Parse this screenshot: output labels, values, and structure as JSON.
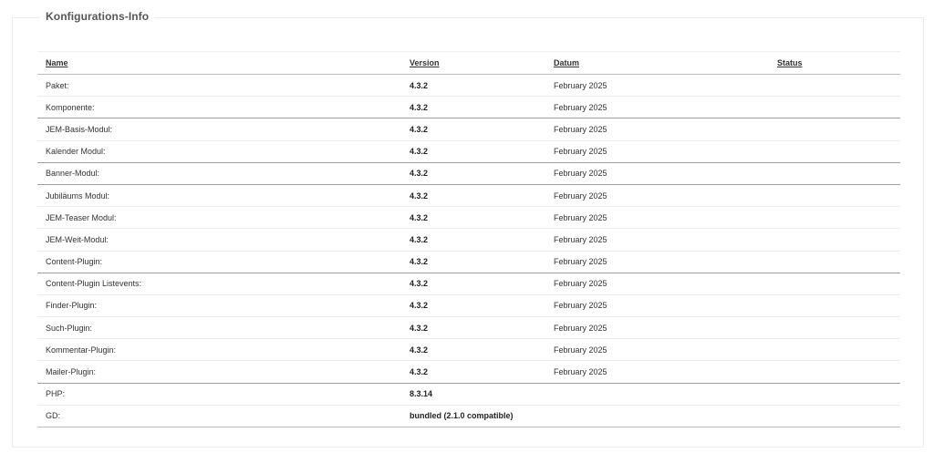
{
  "panel": {
    "legend": "Konfigurations-Info"
  },
  "table": {
    "headers": {
      "name": "Name",
      "version": "Version",
      "datum": "Datum",
      "status": "Status"
    },
    "rows": [
      {
        "name": "Paket:",
        "version": "4.3.2",
        "datum": "February 2025",
        "status": ""
      },
      {
        "name": "Komponente:",
        "version": "4.3.2",
        "datum": "February 2025",
        "status": ""
      },
      {
        "name": "JEM-Basis-Modul:",
        "version": "4.3.2",
        "datum": "February 2025",
        "status": ""
      },
      {
        "name": "Kalender Modul:",
        "version": "4.3.2",
        "datum": "February 2025",
        "status": ""
      },
      {
        "name": "Banner-Modul:",
        "version": "4.3.2",
        "datum": "February 2025",
        "status": ""
      },
      {
        "name": "Jubiläums Modul:",
        "version": "4.3.2",
        "datum": "February 2025",
        "status": ""
      },
      {
        "name": "JEM-Teaser Modul:",
        "version": "4.3.2",
        "datum": "February 2025",
        "status": ""
      },
      {
        "name": "JEM-Weit-Modul:",
        "version": "4.3.2",
        "datum": "February 2025",
        "status": ""
      },
      {
        "name": "Content-Plugin:",
        "version": "4.3.2",
        "datum": "February 2025",
        "status": ""
      },
      {
        "name": "Content-Plugin Listevents:",
        "version": "4.3.2",
        "datum": "February 2025",
        "status": ""
      },
      {
        "name": "Finder-Plugin:",
        "version": "4.3.2",
        "datum": "February 2025",
        "status": ""
      },
      {
        "name": "Such-Plugin:",
        "version": "4.3.2",
        "datum": "February 2025",
        "status": ""
      },
      {
        "name": "Kommentar-Plugin:",
        "version": "4.3.2",
        "datum": "February 2025",
        "status": ""
      },
      {
        "name": "Mailer-Plugin:",
        "version": "4.3.2",
        "datum": "February 2025",
        "status": ""
      },
      {
        "name": "PHP:",
        "version": "8.3.14",
        "datum": "",
        "status": ""
      },
      {
        "name": "GD:",
        "version": "bundled (2.1.0 compatible)",
        "datum": "",
        "status": ""
      }
    ]
  }
}
